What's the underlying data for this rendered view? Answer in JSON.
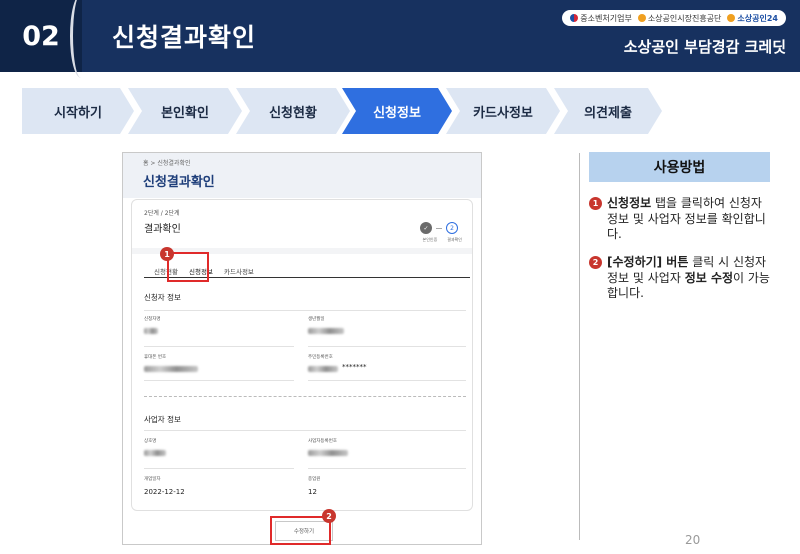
{
  "header": {
    "chapter": "02",
    "title": "신청결과확인",
    "logos": [
      "중소벤처기업부",
      "소상공인시장진흥공단",
      "소상공인24"
    ],
    "program": "소상공인 부담경감 크레딧"
  },
  "steps": [
    {
      "label": "시작하기",
      "active": false
    },
    {
      "label": "본인확인",
      "active": false
    },
    {
      "label": "신청현황",
      "active": false
    },
    {
      "label": "신청정보",
      "active": true
    },
    {
      "label": "카드사정보",
      "active": false
    },
    {
      "label": "의견제출",
      "active": false
    }
  ],
  "mock": {
    "breadcrumb": "홈 > 신청결과확인",
    "title": "신청결과확인",
    "step_count": "2단계 / 2단계",
    "card_heading": "결과확인",
    "progress": {
      "step2": "2",
      "labels": [
        "본인인증",
        "결과확인"
      ]
    },
    "tabs": [
      "신청현황",
      "신청정보",
      "카드사정보"
    ],
    "applicant_section": "신청자 정보",
    "applicant_fields": {
      "name_label": "신청자명",
      "birth_label": "생년월일",
      "phone_label": "휴대폰 번호",
      "rrn_label": "주민등록번호",
      "rrn_suffix": "*******"
    },
    "business_section": "사업자 정보",
    "business_fields": {
      "company_label": "상호명",
      "brn_label": "사업자등록번호",
      "open_date_label": "개업일자",
      "open_date": "2022-12-12",
      "employees_label": "종업원",
      "employees": "12"
    },
    "edit_button": "수정하기",
    "markers": [
      "1",
      "2"
    ]
  },
  "howto": {
    "title": "사용방법",
    "items": [
      {
        "num": "1",
        "bold": "신청정보",
        "text": " 탭을 클릭하여 신청자 정보 및 사업자 정보를 확인합니다."
      },
      {
        "num": "2",
        "bold": "[수정하기] 버튼",
        "text": " 클릭 시 신청자 정보 및 사업자 ",
        "bold2": "정보 수정",
        "text2": "이 가능합니다."
      }
    ]
  },
  "page_number": "20",
  "colors": {
    "header": "#17315f",
    "active_step": "#2f6fe0",
    "inactive_step": "#dde6f3",
    "highlight": "#e02a2a",
    "howto_bg": "#b7d2ee"
  }
}
